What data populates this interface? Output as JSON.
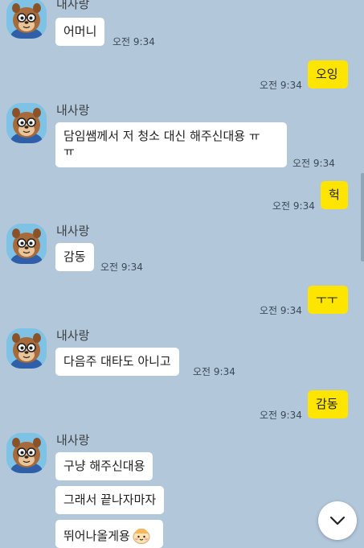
{
  "chat": {
    "sender": "내사랑",
    "messages": [
      {
        "text": "어머니",
        "time": "오전 9:34"
      },
      {
        "text": "오잉",
        "time": "오전 9:34"
      },
      {
        "text_line1": "담임쌤께서 저 청소 대신 해주신대용 ㅠ",
        "text_line2": "ㅠ",
        "time": "오전 9:34"
      },
      {
        "text": "헉",
        "time": "오전 9:34"
      },
      {
        "text": "감동",
        "time": "오전 9:34"
      },
      {
        "text": "ㅜㅜ",
        "time": "오전 9:34"
      },
      {
        "text": "다음주 대타도 아니고",
        "time": "오전 9:34"
      },
      {
        "text": "감동",
        "time": "오전 9:34"
      },
      {
        "text": "구냥 해주신대용"
      },
      {
        "text": "그래서 끝나자마자"
      },
      {
        "text": "뛰어나올게용"
      }
    ]
  },
  "icons": {
    "avatar": "chipmunk-avatar-icon",
    "emoji": "smiling-face-emoji-icon",
    "scroll": "chevron-down-icon"
  },
  "colors": {
    "background": "#b2c7da",
    "incoming_bubble": "#ffffff",
    "outgoing_bubble": "#fee500"
  }
}
